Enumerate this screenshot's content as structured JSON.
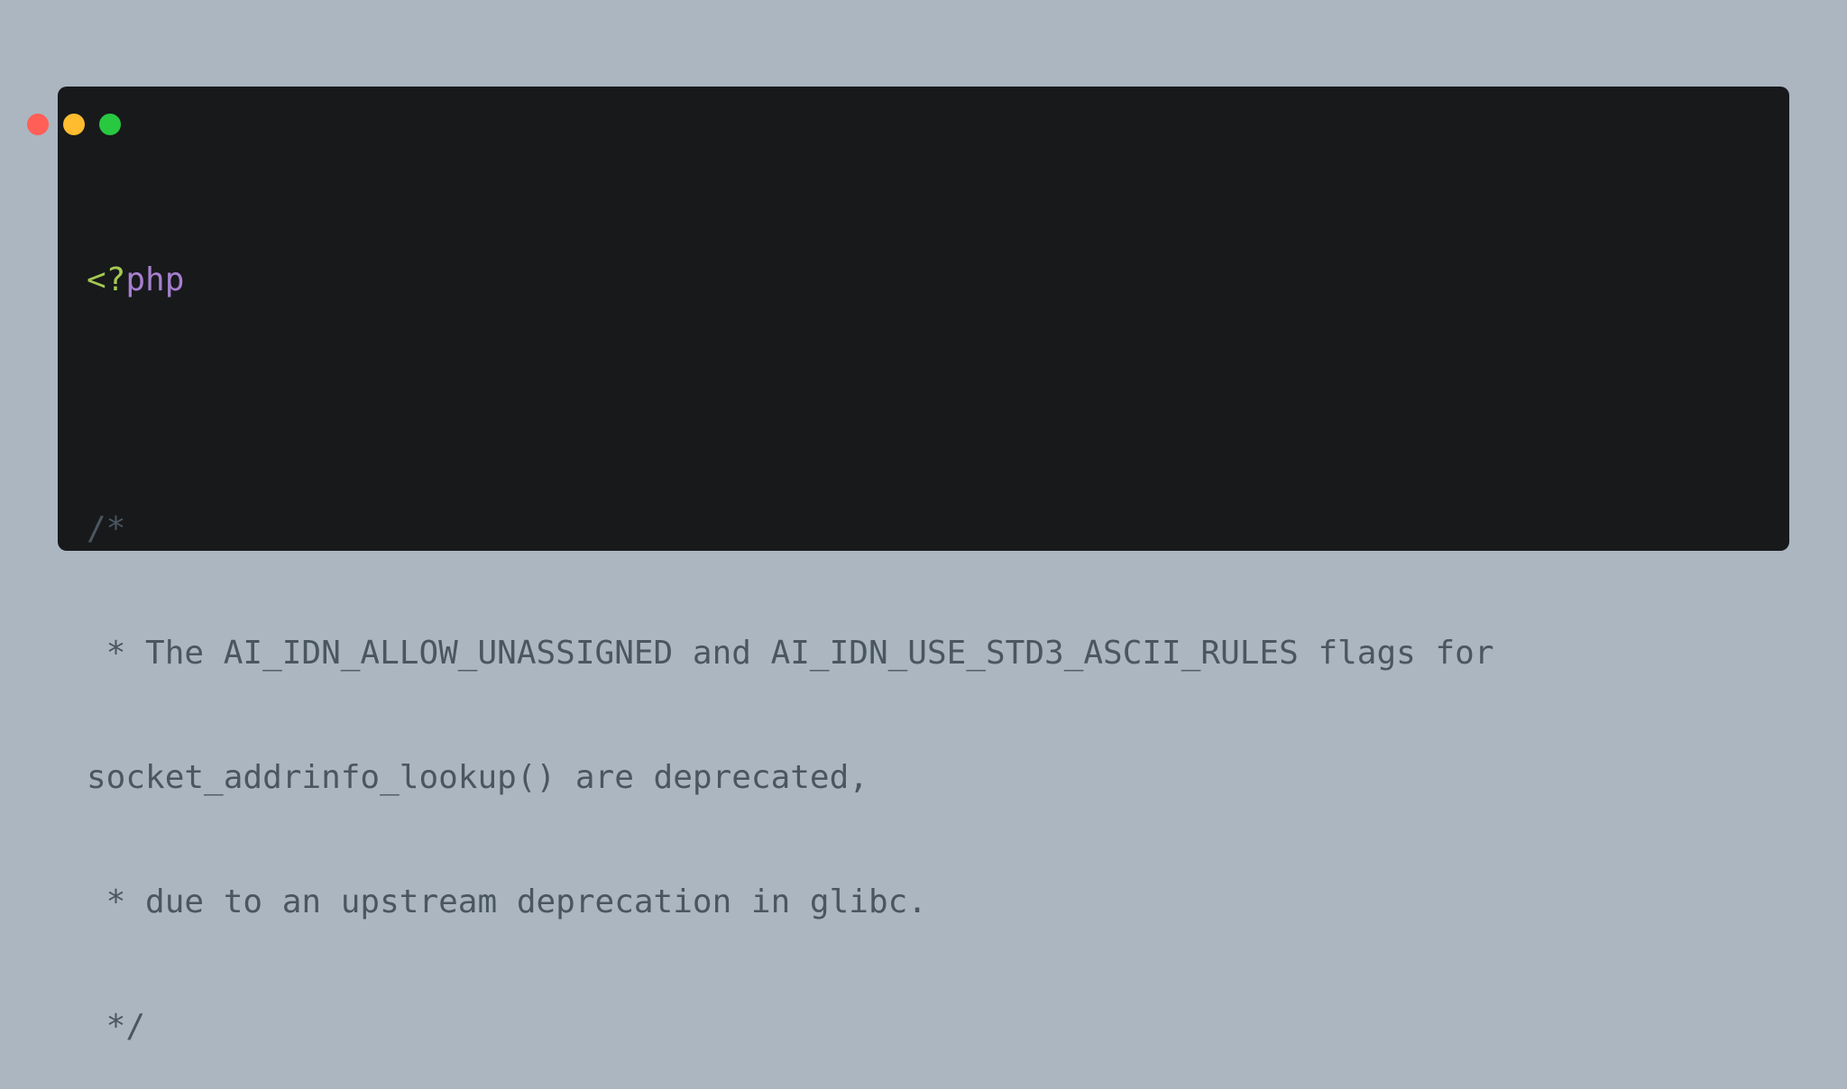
{
  "window": {
    "controls": {
      "close": "close-control",
      "minimize": "minimize-control",
      "maximize": "maximize-control"
    },
    "colors": {
      "background": "#17191b",
      "page_background": "#abb6c1",
      "close": "#ff5f57",
      "minimize": "#febc2e",
      "maximize": "#28c840"
    }
  },
  "code": {
    "php_open_bracket": "<?",
    "php_keyword": "php",
    "comment_lines": [
      "/*",
      " * The AI_IDN_ALLOW_UNASSIGNED and AI_IDN_USE_STD3_ASCII_RULES flags for",
      "socket_addrinfo_lookup() are deprecated,",
      " * due to an upstream deprecation in glibc.",
      " */"
    ],
    "colors": {
      "php_open_bracket": "#a4c851",
      "php_keyword": "#a77fce",
      "comment": "#4a5660"
    }
  }
}
